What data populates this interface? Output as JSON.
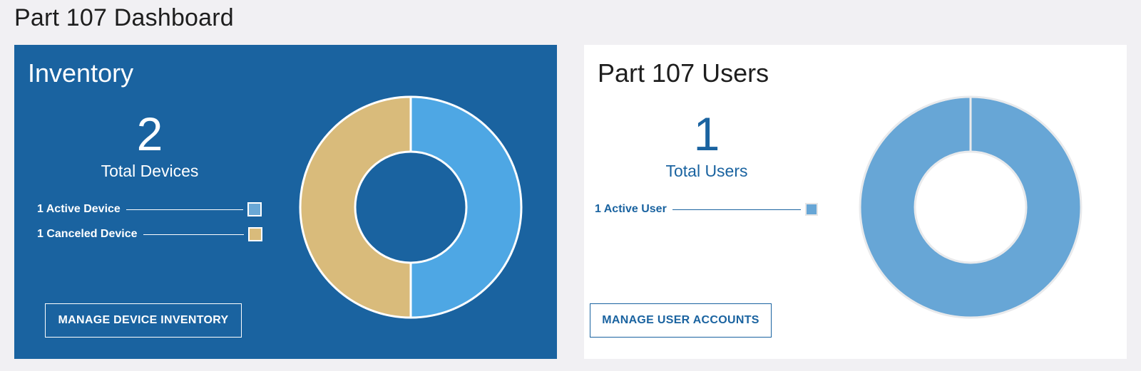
{
  "page": {
    "title": "Part 107 Dashboard"
  },
  "inventory": {
    "title": "Inventory",
    "total": "2",
    "total_label": "Total Devices",
    "legend": [
      {
        "label": "1 Active Device",
        "color": "#6aa8d6"
      },
      {
        "label": "1 Canceled Device",
        "color": "#d9bb7b"
      }
    ],
    "button_label": "MANAGE DEVICE INVENTORY",
    "chart_data": {
      "type": "pie",
      "categories": [
        "Active",
        "Canceled"
      ],
      "values": [
        1,
        1
      ],
      "colors": [
        "#4ea7e4",
        "#d9bb7b"
      ],
      "hole_color": "#1a63a0"
    }
  },
  "users": {
    "title": "Part 107 Users",
    "total": "1",
    "total_label": "Total Users",
    "legend": [
      {
        "label": "1 Active User",
        "color": "#67a6d6"
      }
    ],
    "button_label": "MANAGE USER ACCOUNTS",
    "chart_data": {
      "type": "pie",
      "categories": [
        "Active"
      ],
      "values": [
        1
      ],
      "colors": [
        "#67a6d6"
      ],
      "hole_color": "#ffffff"
    }
  },
  "theme": {
    "inventory_bg": "#1a63a0",
    "users_bg": "#ffffff",
    "page_bg": "#f1f0f3"
  }
}
